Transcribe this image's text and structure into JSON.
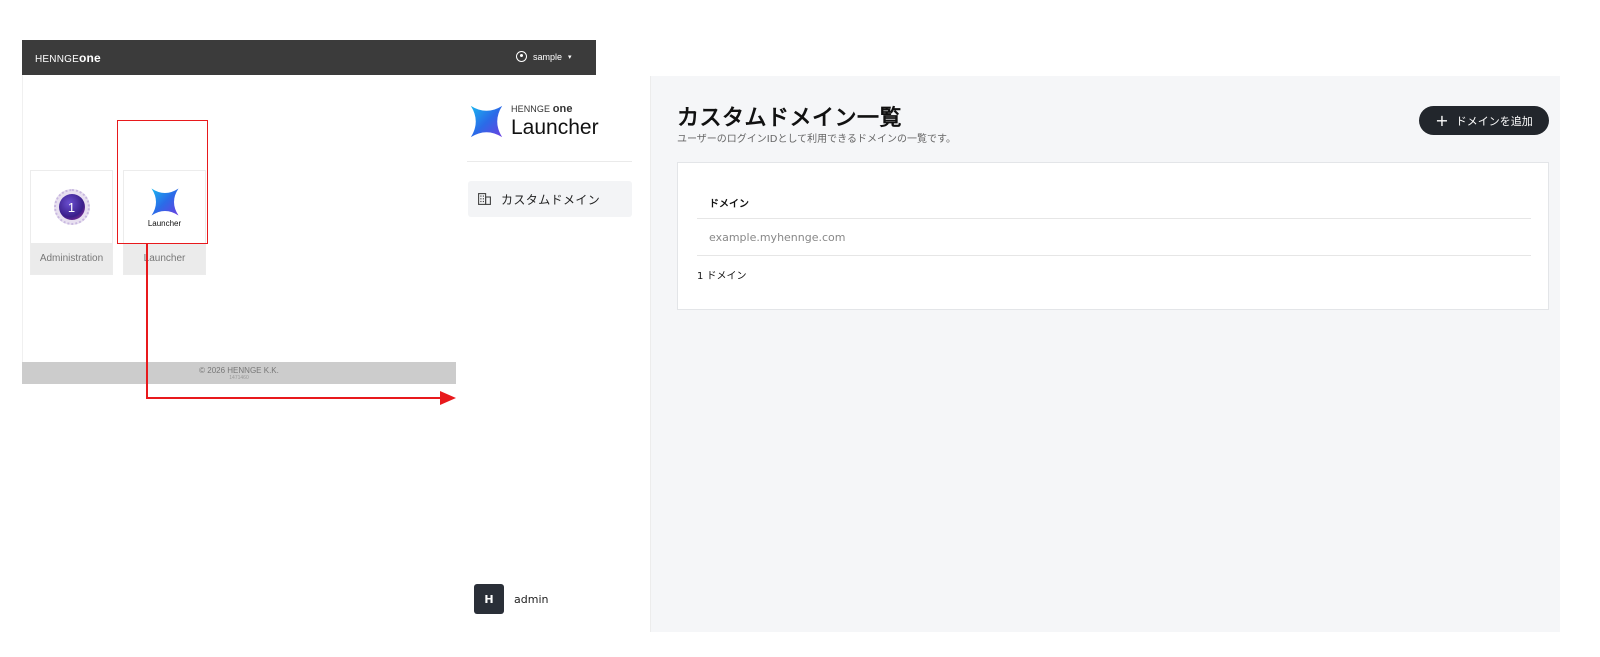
{
  "portal": {
    "topbar": {
      "logo_prefix": "HENNGE",
      "logo_suffix": "one",
      "user_name": "sample",
      "caret": "▾"
    },
    "tiles": [
      {
        "label": "Administration",
        "badge_number": "1",
        "icon": "administration-badge-icon"
      },
      {
        "label": "Launcher",
        "mini_label": "Launcher",
        "icon": "launcher-star-icon"
      }
    ],
    "footer": {
      "copyright": "© 2026 HENNGE K.K.",
      "version": "1471460"
    }
  },
  "sidebar": {
    "brand_prefix": "HENNGE",
    "brand_suffix": "one",
    "brand_name": "Launcher",
    "nav_items": [
      {
        "label": "カスタムドメイン",
        "icon": "building-icon"
      }
    ],
    "user": {
      "initial": "H",
      "name": "admin"
    }
  },
  "main": {
    "title": "カスタムドメイン一覧",
    "subtitle": "ユーザーのログインIDとして利用できるドメインの一覧です。",
    "add_button_label": "ドメインを追加",
    "table": {
      "column_header": "ドメイン",
      "rows": [
        "example.myhennge.com"
      ],
      "count_label": "1 ドメイン"
    }
  },
  "colors": {
    "highlight": "#e8191c",
    "topbar": "#3b3b3b",
    "button": "#22262c",
    "main_bg": "#f5f6f8"
  }
}
